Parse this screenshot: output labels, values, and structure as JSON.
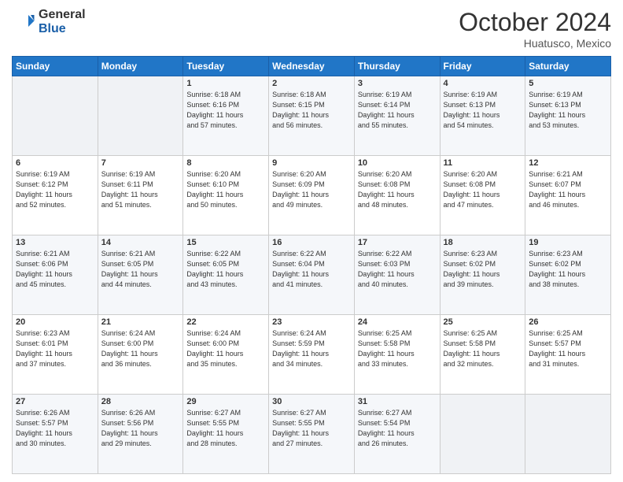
{
  "logo": {
    "general": "General",
    "blue": "Blue"
  },
  "header": {
    "month": "October 2024",
    "location": "Huatusco, Mexico"
  },
  "weekdays": [
    "Sunday",
    "Monday",
    "Tuesday",
    "Wednesday",
    "Thursday",
    "Friday",
    "Saturday"
  ],
  "weeks": [
    [
      {
        "day": "",
        "info": ""
      },
      {
        "day": "",
        "info": ""
      },
      {
        "day": "1",
        "info": "Sunrise: 6:18 AM\nSunset: 6:16 PM\nDaylight: 11 hours\nand 57 minutes."
      },
      {
        "day": "2",
        "info": "Sunrise: 6:18 AM\nSunset: 6:15 PM\nDaylight: 11 hours\nand 56 minutes."
      },
      {
        "day": "3",
        "info": "Sunrise: 6:19 AM\nSunset: 6:14 PM\nDaylight: 11 hours\nand 55 minutes."
      },
      {
        "day": "4",
        "info": "Sunrise: 6:19 AM\nSunset: 6:13 PM\nDaylight: 11 hours\nand 54 minutes."
      },
      {
        "day": "5",
        "info": "Sunrise: 6:19 AM\nSunset: 6:13 PM\nDaylight: 11 hours\nand 53 minutes."
      }
    ],
    [
      {
        "day": "6",
        "info": "Sunrise: 6:19 AM\nSunset: 6:12 PM\nDaylight: 11 hours\nand 52 minutes."
      },
      {
        "day": "7",
        "info": "Sunrise: 6:19 AM\nSunset: 6:11 PM\nDaylight: 11 hours\nand 51 minutes."
      },
      {
        "day": "8",
        "info": "Sunrise: 6:20 AM\nSunset: 6:10 PM\nDaylight: 11 hours\nand 50 minutes."
      },
      {
        "day": "9",
        "info": "Sunrise: 6:20 AM\nSunset: 6:09 PM\nDaylight: 11 hours\nand 49 minutes."
      },
      {
        "day": "10",
        "info": "Sunrise: 6:20 AM\nSunset: 6:08 PM\nDaylight: 11 hours\nand 48 minutes."
      },
      {
        "day": "11",
        "info": "Sunrise: 6:20 AM\nSunset: 6:08 PM\nDaylight: 11 hours\nand 47 minutes."
      },
      {
        "day": "12",
        "info": "Sunrise: 6:21 AM\nSunset: 6:07 PM\nDaylight: 11 hours\nand 46 minutes."
      }
    ],
    [
      {
        "day": "13",
        "info": "Sunrise: 6:21 AM\nSunset: 6:06 PM\nDaylight: 11 hours\nand 45 minutes."
      },
      {
        "day": "14",
        "info": "Sunrise: 6:21 AM\nSunset: 6:05 PM\nDaylight: 11 hours\nand 44 minutes."
      },
      {
        "day": "15",
        "info": "Sunrise: 6:22 AM\nSunset: 6:05 PM\nDaylight: 11 hours\nand 43 minutes."
      },
      {
        "day": "16",
        "info": "Sunrise: 6:22 AM\nSunset: 6:04 PM\nDaylight: 11 hours\nand 41 minutes."
      },
      {
        "day": "17",
        "info": "Sunrise: 6:22 AM\nSunset: 6:03 PM\nDaylight: 11 hours\nand 40 minutes."
      },
      {
        "day": "18",
        "info": "Sunrise: 6:23 AM\nSunset: 6:02 PM\nDaylight: 11 hours\nand 39 minutes."
      },
      {
        "day": "19",
        "info": "Sunrise: 6:23 AM\nSunset: 6:02 PM\nDaylight: 11 hours\nand 38 minutes."
      }
    ],
    [
      {
        "day": "20",
        "info": "Sunrise: 6:23 AM\nSunset: 6:01 PM\nDaylight: 11 hours\nand 37 minutes."
      },
      {
        "day": "21",
        "info": "Sunrise: 6:24 AM\nSunset: 6:00 PM\nDaylight: 11 hours\nand 36 minutes."
      },
      {
        "day": "22",
        "info": "Sunrise: 6:24 AM\nSunset: 6:00 PM\nDaylight: 11 hours\nand 35 minutes."
      },
      {
        "day": "23",
        "info": "Sunrise: 6:24 AM\nSunset: 5:59 PM\nDaylight: 11 hours\nand 34 minutes."
      },
      {
        "day": "24",
        "info": "Sunrise: 6:25 AM\nSunset: 5:58 PM\nDaylight: 11 hours\nand 33 minutes."
      },
      {
        "day": "25",
        "info": "Sunrise: 6:25 AM\nSunset: 5:58 PM\nDaylight: 11 hours\nand 32 minutes."
      },
      {
        "day": "26",
        "info": "Sunrise: 6:25 AM\nSunset: 5:57 PM\nDaylight: 11 hours\nand 31 minutes."
      }
    ],
    [
      {
        "day": "27",
        "info": "Sunrise: 6:26 AM\nSunset: 5:57 PM\nDaylight: 11 hours\nand 30 minutes."
      },
      {
        "day": "28",
        "info": "Sunrise: 6:26 AM\nSunset: 5:56 PM\nDaylight: 11 hours\nand 29 minutes."
      },
      {
        "day": "29",
        "info": "Sunrise: 6:27 AM\nSunset: 5:55 PM\nDaylight: 11 hours\nand 28 minutes."
      },
      {
        "day": "30",
        "info": "Sunrise: 6:27 AM\nSunset: 5:55 PM\nDaylight: 11 hours\nand 27 minutes."
      },
      {
        "day": "31",
        "info": "Sunrise: 6:27 AM\nSunset: 5:54 PM\nDaylight: 11 hours\nand 26 minutes."
      },
      {
        "day": "",
        "info": ""
      },
      {
        "day": "",
        "info": ""
      }
    ]
  ]
}
